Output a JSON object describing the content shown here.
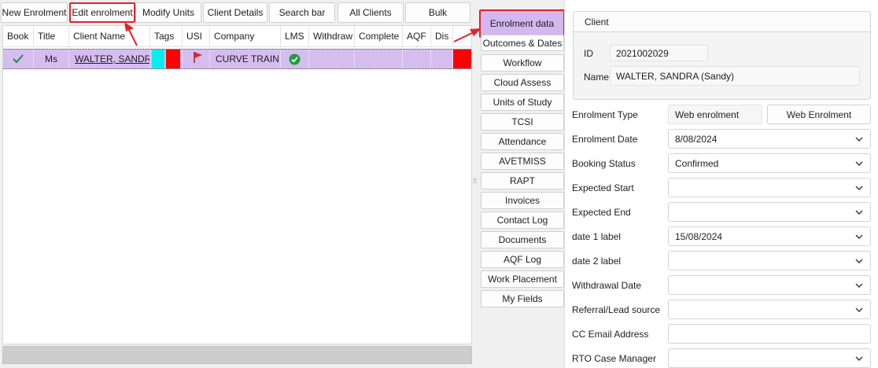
{
  "toolbar": {
    "new_enrolment": "New Enrolment",
    "edit_enrolment": "Edit enrolment",
    "modify_units": "Modify Units",
    "client_details": "Client Details",
    "search_bar": "Search bar",
    "all_clients": "All Clients",
    "bulk": "Bulk"
  },
  "grid": {
    "columns": [
      "Book",
      "Title",
      "Client Name",
      "Tags",
      "USI",
      "Company",
      "LMS",
      "Withdraw",
      "Complete",
      "AQF",
      "Dis"
    ],
    "row": {
      "title": "Ms",
      "client_name": "WALTER, SANDRA",
      "company": "CURVE TRAININ",
      "book_icon": "checkmark-icon",
      "usi_icon": "red-flag-icon",
      "lms_icon": "green-check-circle-icon"
    }
  },
  "side_tabs": [
    "Enrolment data",
    "Outcomes & Dates",
    "Workflow",
    "Cloud Assess",
    "Units of Study",
    "TCSI",
    "Attendance",
    "AVETMISS",
    "RAPT",
    "Invoices",
    "Contact Log",
    "Documents",
    "AQF Log",
    "Work Placement",
    "My Fields"
  ],
  "client": {
    "header": "Client",
    "id_label": "ID",
    "id_value": "2021002029",
    "name_label": "Name",
    "name_value": "WALTER, SANDRA (Sandy)"
  },
  "fields": {
    "enrolment_type_label": "Enrolment Type",
    "enrolment_type_value": "Web enrolment",
    "enrolment_type_button": "Web Enrolment",
    "enrolment_date_label": "Enrolment Date",
    "enrolment_date_value": "8/08/2024",
    "booking_status_label": "Booking Status",
    "booking_status_value": "Confirmed",
    "expected_start_label": "Expected Start",
    "expected_start_value": "",
    "expected_end_label": "Expected End",
    "expected_end_value": "",
    "date1_label": "date 1 label",
    "date1_value": "15/08/2024",
    "date2_label": "date 2 label",
    "date2_value": "",
    "withdrawal_date_label": "Withdrawal Date",
    "withdrawal_date_value": "",
    "referral_label": "Referral/Lead source",
    "referral_value": "",
    "cc_email_label": "CC Email Address",
    "cc_email_value": "",
    "rto_case_manager_label": "RTO Case Manager",
    "rto_case_manager_value": ""
  },
  "colors": {
    "selection": "#d5bdf0",
    "active_tab": "#d3b8f0",
    "annotation_red": "#e0242b",
    "tag_cyan": "#00f0f0",
    "tag_red": "#ff0000",
    "lms_green": "#1f9d3a"
  }
}
